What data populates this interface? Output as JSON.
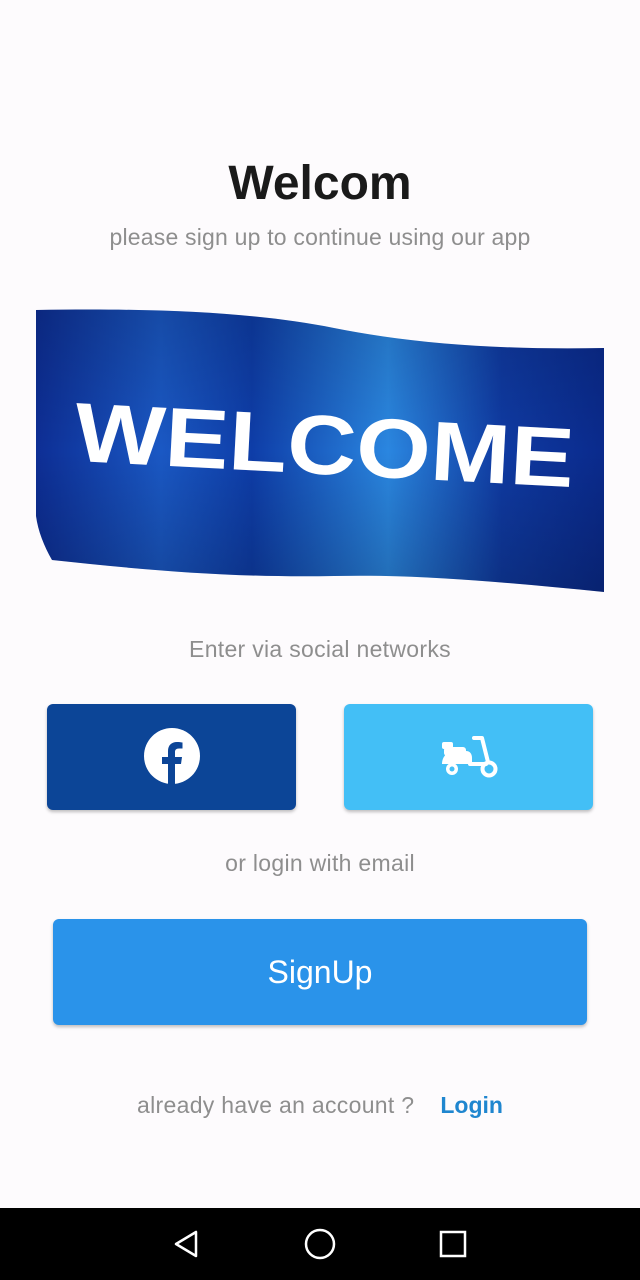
{
  "header": {
    "title": "Welcom",
    "subtitle": "please sign up to continue using our app"
  },
  "banner": {
    "text": "WELCOME",
    "colors": {
      "flag_dark": "#0a2a8c",
      "flag_light": "#1e6fd2",
      "text": "#ffffff"
    }
  },
  "social": {
    "caption": "Enter via social networks",
    "facebook": {
      "icon": "facebook-icon",
      "color": "#0c4597"
    },
    "scooter": {
      "icon": "scooter-icon",
      "color": "#43bff6"
    }
  },
  "email": {
    "caption": "or login with email"
  },
  "signup": {
    "label": "SignUp",
    "color": "#2a93ea"
  },
  "account": {
    "prompt": "already have an account ?",
    "login_label": "Login"
  },
  "navbar": {
    "back_icon": "back-triangle-icon",
    "home_icon": "home-circle-icon",
    "recents_icon": "recents-square-icon"
  }
}
